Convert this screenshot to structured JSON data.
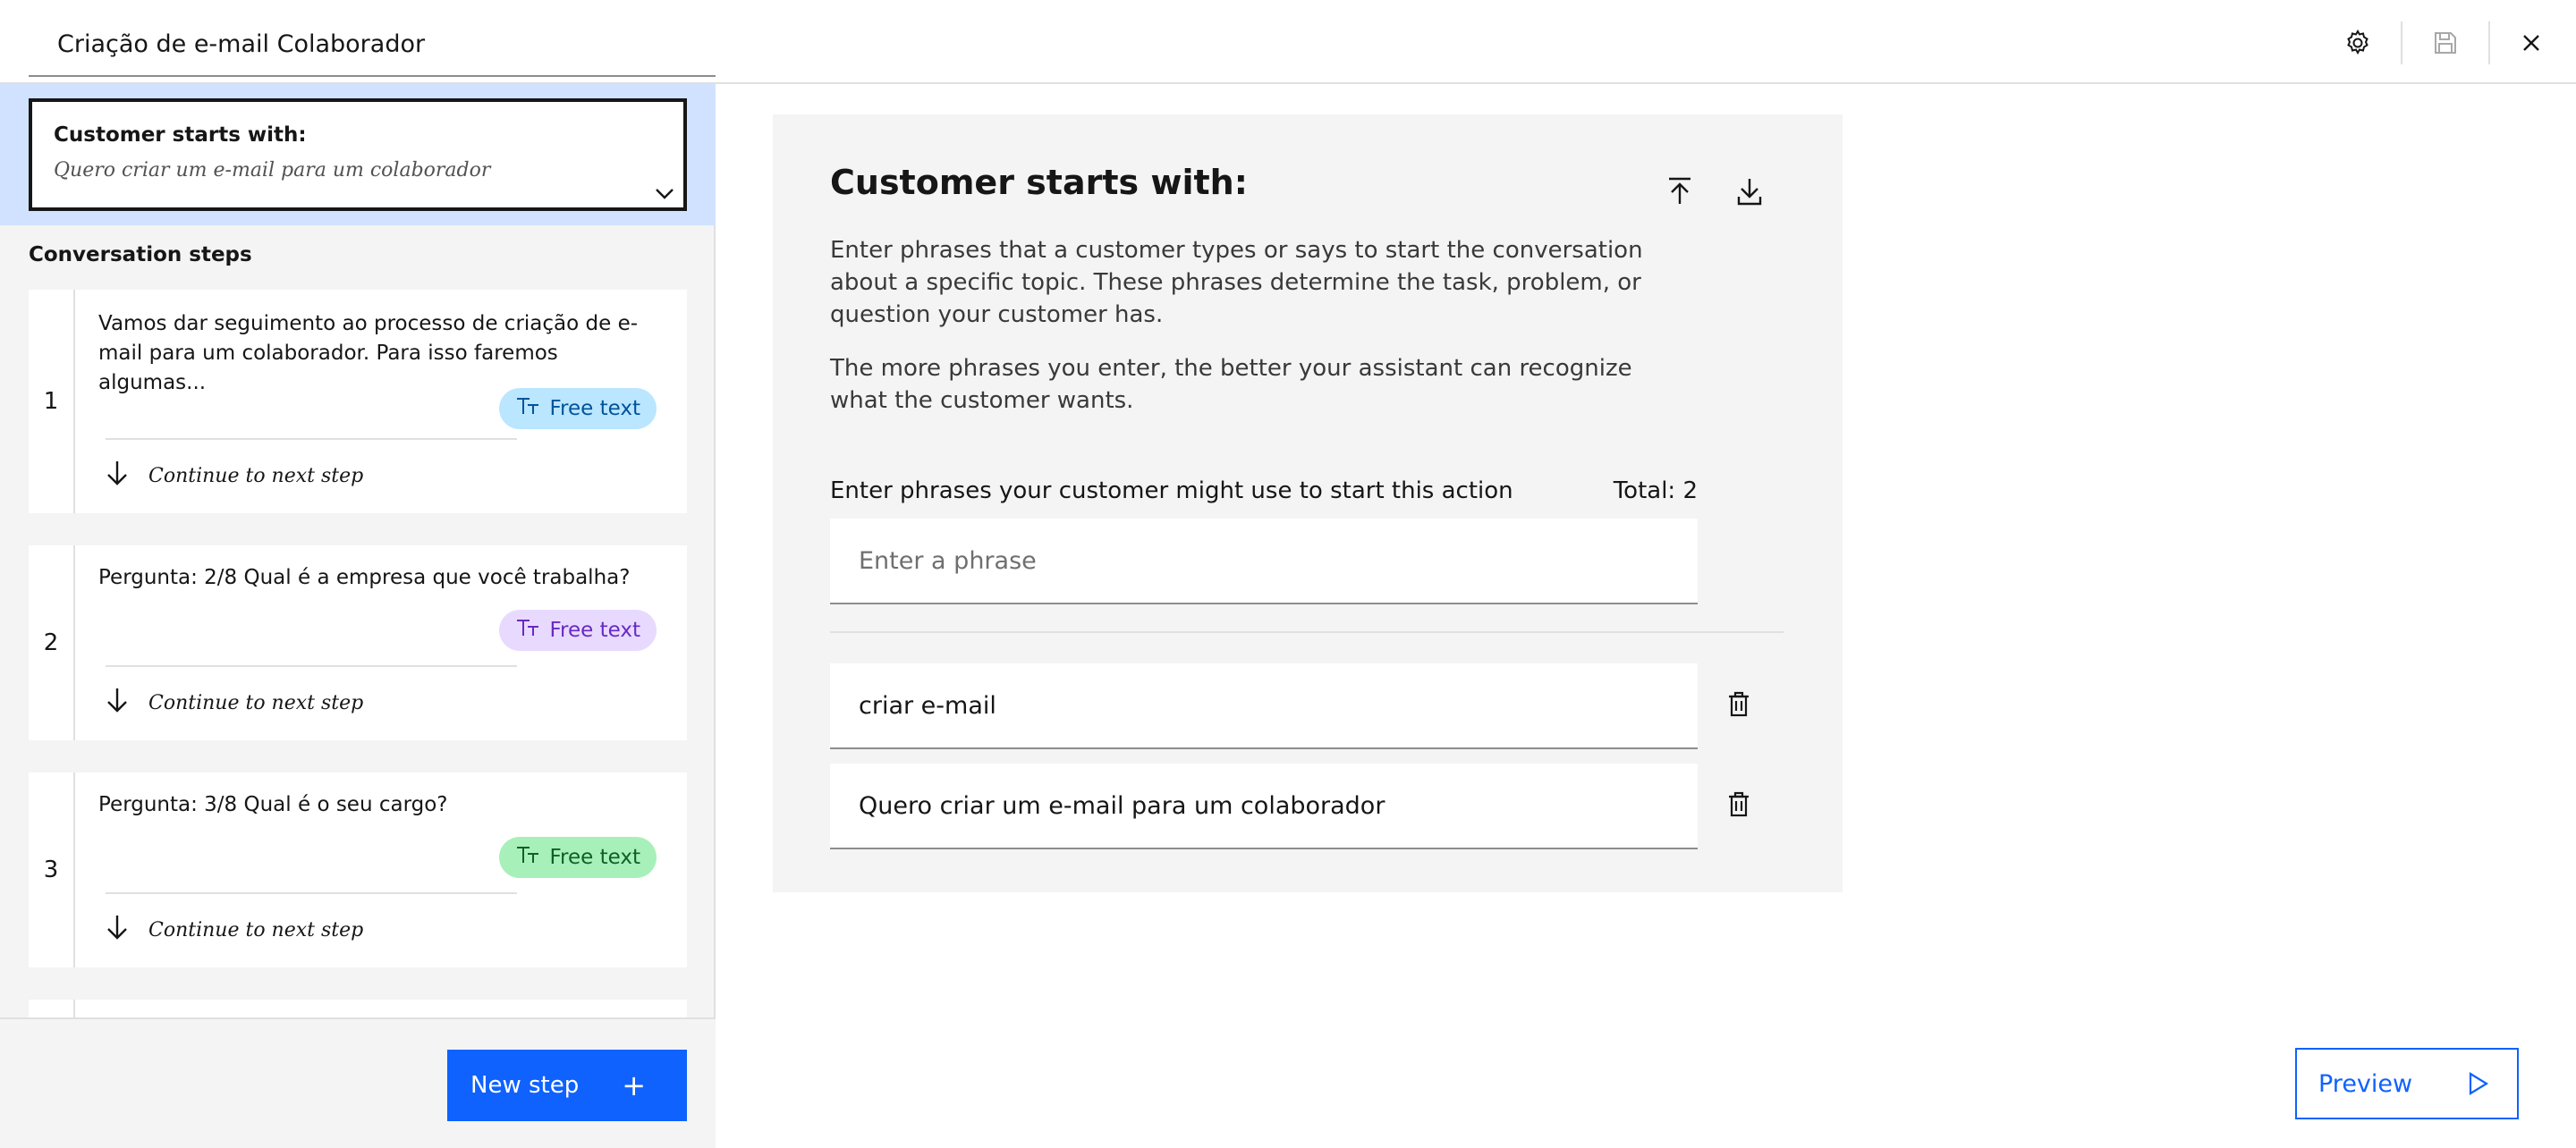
{
  "header": {
    "title": "Criação de e-mail Colaborador",
    "settings_icon": "gear-icon",
    "save_icon": "save-icon",
    "close_icon": "close-icon"
  },
  "sidebar": {
    "starts_with": {
      "title": "Customer starts with:",
      "subtitle": "Quero criar um e-mail para um colaborador"
    },
    "steps_heading": "Conversation steps",
    "steps": [
      {
        "number": "1",
        "text": "Vamos dar seguimento ao processo de criação de e-mail para um colaborador. Para isso faremos algumas...",
        "tag": "Free text",
        "next": "Continue to next step"
      },
      {
        "number": "2",
        "text": "Pergunta: 2/8 Qual é a empresa que você trabalha?",
        "tag": "Free text",
        "next": "Continue to next step"
      },
      {
        "number": "3",
        "text": "Pergunta: 3/8 Qual é o seu cargo?",
        "tag": "Free text",
        "next": "Continue to next step"
      }
    ],
    "new_step_label": "New step",
    "new_step_icon": "+"
  },
  "main": {
    "title": "Customer starts with:",
    "paragraph1": "Enter phrases that a customer types or says to start the conversation about a specific topic. These phrases determine the task, problem, or question your customer has.",
    "paragraph2": "The more phrases you enter, the better your assistant can recognize what the customer wants.",
    "phrases_label": "Enter phrases your customer might use to start this action",
    "total_label": "Total: 2",
    "input_placeholder": "Enter a phrase",
    "phrases": [
      "criar e-mail",
      "Quero criar um e-mail para um colaborador"
    ],
    "upload_icon": "upload-icon",
    "download_icon": "download-icon"
  },
  "footer": {
    "preview_label": "Preview"
  },
  "colors": {
    "primary": "#0f62fe",
    "selected_bg": "#d0e2ff",
    "tag_blue": "#bae6ff",
    "tag_purple": "#e8daff",
    "tag_green": "#a7f0ba"
  }
}
